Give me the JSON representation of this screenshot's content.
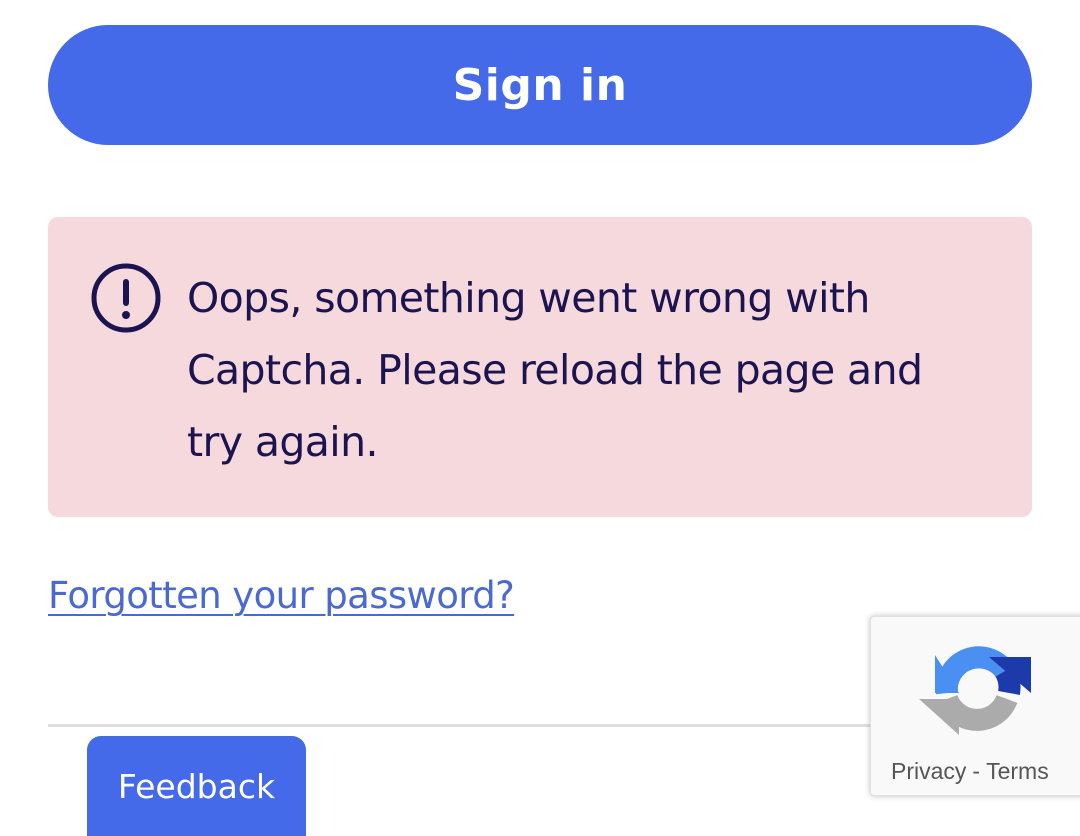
{
  "signin": {
    "label": "Sign in"
  },
  "alert": {
    "icon": "exclamation-circle-icon",
    "lines": [
      "Oops, something went wrong with",
      "Captcha. Please reload the page and",
      "try again."
    ]
  },
  "forgot_password": {
    "label": "Forgotten your password?"
  },
  "feedback": {
    "label": "Feedback"
  },
  "recaptcha": {
    "icon": "recaptcha-logo-icon",
    "privacy": "Privacy",
    "separator": "-",
    "terms": "Terms"
  },
  "colors": {
    "primary": "#4469e9",
    "alert_bg": "#f6d9dc",
    "alert_text": "#1c1450",
    "link": "#4a69d3"
  }
}
